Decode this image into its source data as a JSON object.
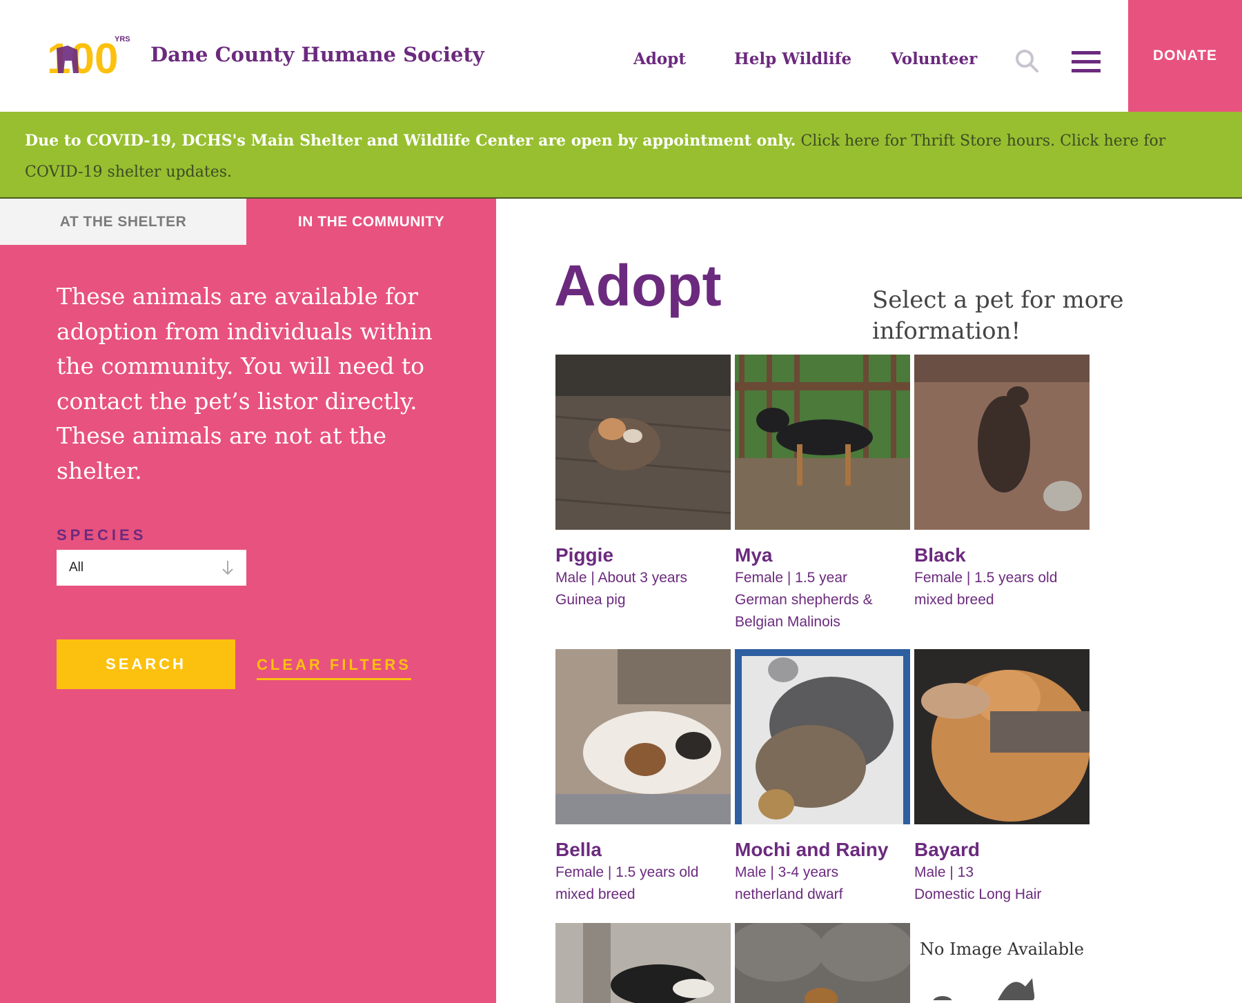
{
  "header": {
    "logo_text": "100",
    "logo_sub": "YRS",
    "brand_name": "Dane County Humane Society",
    "nav": [
      "Adopt",
      "Help Wildlife",
      "Volunteer"
    ],
    "donate_label": "DONATE",
    "colors": {
      "brand_purple": "#6b2a7e",
      "pink": "#e8527e",
      "yellow": "#fcc10e",
      "green": "#97bf30"
    }
  },
  "alert": {
    "bold_text": "Due to COVID-19, DCHS's Main Shelter and Wildlife Center are open by appointment only.",
    "link1": "Click here for Thrift Store hours.",
    "link2": "Click here for COVID-19 shelter updates."
  },
  "tabs": {
    "shelter": "AT THE SHELTER",
    "community": "IN THE COMMUNITY"
  },
  "sidebar": {
    "intro": "These animals are available for adoption from individuals within the community. You will need to contact the pet’s listor directly. These animals are not at the shelter.",
    "species_label": "SPECIES",
    "species_value": "All",
    "search_label": "SEARCH",
    "clear_label": "CLEAR FILTERS"
  },
  "main": {
    "title": "Adopt",
    "note": "Select a pet for more information!",
    "pets": [
      {
        "name": "Piggie",
        "info": "Male | About 3 years",
        "breed": "Guinea pig"
      },
      {
        "name": "Mya",
        "info": "Female | 1.5 year",
        "breed": "German shepherds & Belgian Malinois"
      },
      {
        "name": "Black",
        "info": "Female | 1.5 years old",
        "breed": "mixed breed"
      },
      {
        "name": "Bella",
        "info": "Female | 1.5 years old",
        "breed": "mixed breed"
      },
      {
        "name": "Mochi and Rainy",
        "info": "Male | 3-4 years",
        "breed": "netherland dwarf"
      },
      {
        "name": "Bayard",
        "info": "Male | 13",
        "breed": "Domestic Long Hair"
      }
    ],
    "no_image_text": "No Image Available"
  }
}
